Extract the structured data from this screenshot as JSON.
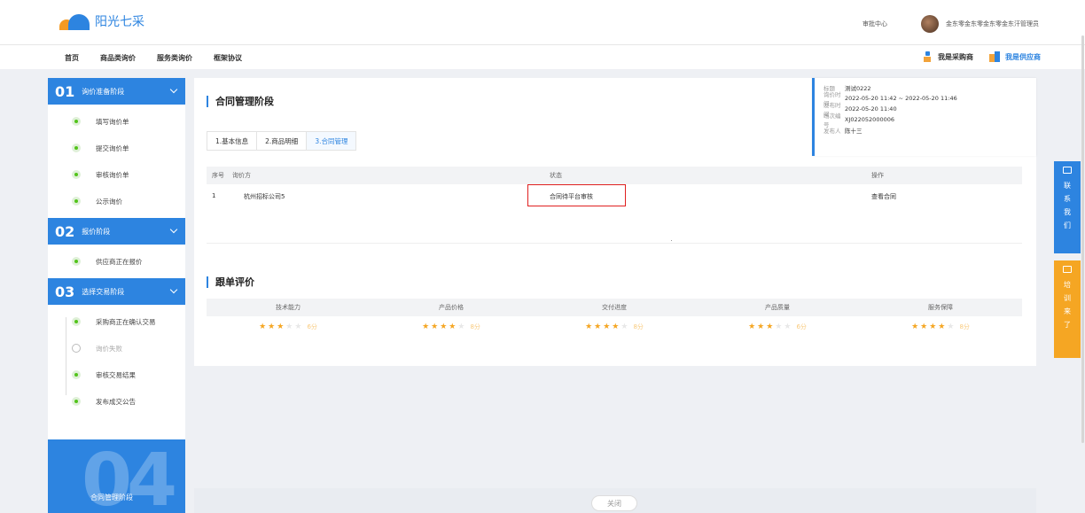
{
  "header": {
    "logo_text": "阳光七采",
    "approval_center": "审批中心",
    "user_name": "金东零金东零金东零金东汗管理员"
  },
  "nav": {
    "items": [
      "首页",
      "商品类询价",
      "服务类询价",
      "框架协议"
    ],
    "buyer_link": "我是采购商",
    "supplier_link": "我是供应商"
  },
  "sidebar": {
    "stages": [
      {
        "num": "01",
        "title": "询价准备阶段",
        "steps": [
          {
            "label": "填写询价单",
            "done": true
          },
          {
            "label": "提交询价单",
            "done": true
          },
          {
            "label": "审核询价单",
            "done": true
          },
          {
            "label": "公示询价",
            "done": true
          }
        ]
      },
      {
        "num": "02",
        "title": "报价阶段",
        "steps": [
          {
            "label": "供应商正在报价",
            "done": true
          }
        ]
      },
      {
        "num": "03",
        "title": "选择交易阶段",
        "steps": [
          {
            "label": "采购商正在确认交易",
            "done": true
          },
          {
            "label": "询价失败",
            "done": false
          },
          {
            "label": "审核交易结果",
            "done": true
          },
          {
            "label": "发布成交公告",
            "done": true
          }
        ]
      }
    ],
    "current_stage_num": "04",
    "current_stage_label": "合同管理阶段"
  },
  "main": {
    "section_title": "合同管理阶段",
    "tabs": [
      {
        "label": "1.基本信息",
        "active": false
      },
      {
        "label": "2.商品明细",
        "active": false
      },
      {
        "label": "3.合同管理",
        "active": true
      }
    ],
    "table": {
      "headers": [
        "序号",
        "询价方",
        "状态",
        "操作"
      ],
      "rows": [
        {
          "index": "1",
          "party": "杭州招标公司5",
          "status": "合同待平台审核",
          "action": "查看合同"
        }
      ]
    },
    "eval_title": "跟单评价",
    "eval_headers": [
      "技术能力",
      "产品价格",
      "交付进度",
      "产品质量",
      "服务保障"
    ],
    "eval_ratings": [
      {
        "stars": 3,
        "score": "6分"
      },
      {
        "stars": 4,
        "score": "8分"
      },
      {
        "stars": 4,
        "score": "8分"
      },
      {
        "stars": 3,
        "score": "6分"
      },
      {
        "stars": 4,
        "score": "8分"
      }
    ]
  },
  "info": {
    "title_key": "标题",
    "title_val": "测试0222",
    "time_key": "询价时间",
    "time_val": "2022-05-20 11:42 ~ 2022-05-20 11:46",
    "publish_key": "发布时间",
    "publish_val": "2022-05-20 11:40",
    "code_key": "场次编号",
    "code_val": "XJ022052000006",
    "publisher_key": "发布人",
    "publisher_val": "陈十三"
  },
  "float": {
    "contact": [
      "联",
      "系",
      "我",
      "们"
    ],
    "training": [
      "培",
      "训",
      "来",
      "了"
    ]
  },
  "bottom": {
    "close_label": "关闭"
  },
  "colors": {
    "primary": "#2d84e0",
    "accent_orange": "#f5a623",
    "alert_red": "#e02020",
    "done_green": "#52c41a"
  }
}
